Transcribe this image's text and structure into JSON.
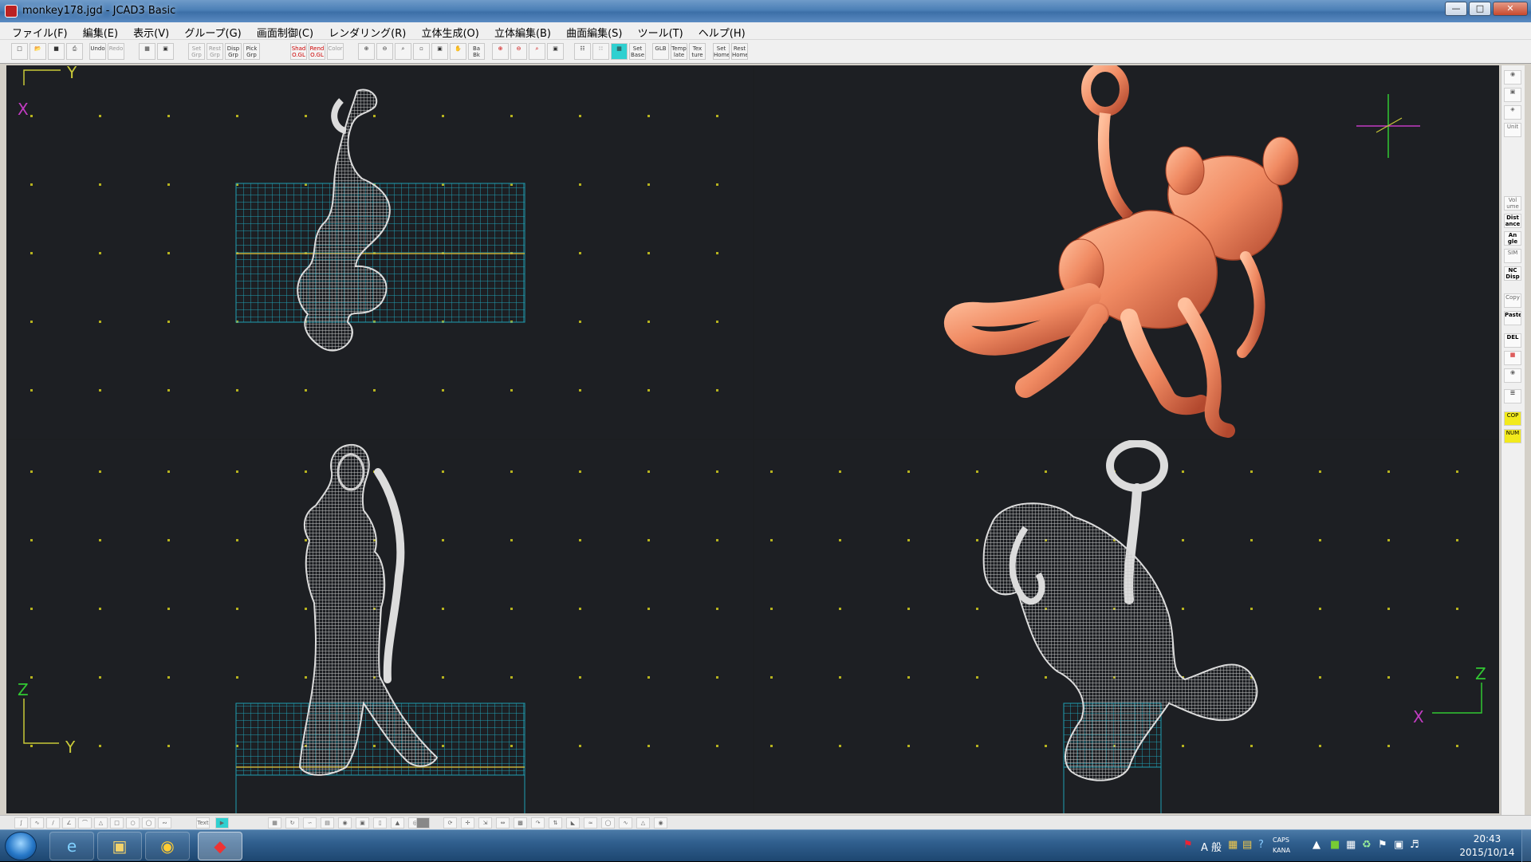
{
  "window": {
    "title": "monkey178.jgd - JCAD3 Basic"
  },
  "menu": [
    "ファイル(F)",
    "編集(E)",
    "表示(V)",
    "グループ(G)",
    "画面制御(C)",
    "レンダリング(R)",
    "立体生成(O)",
    "立体編集(B)",
    "曲面編集(S)",
    "ツール(T)",
    "ヘルプ(H)"
  ],
  "toolbar": {
    "undo": "Undo",
    "redo": "Redo",
    "set_grp": "Set Grp",
    "reset_grp": "Rest Grp",
    "disp_grp": "Disp Grp",
    "pick_grp": "Pick Grp",
    "shad_ogl": "Shad O.GL",
    "rend_ogl": "Rend O.GL",
    "color": "Color",
    "ba_bk": "Ba Bk",
    "set_base": "Set Base",
    "glb": "GLB",
    "template": "Temp late",
    "texture": "Tex ture",
    "set_home": "Set Home",
    "rest_home": "Rest Home"
  },
  "viewports": {
    "top_left": {
      "axis_h": "Y",
      "axis_v": "X"
    },
    "bottom_left": {
      "axis_v": "Z",
      "axis_h": "Y"
    },
    "bottom_right": {
      "axis_v": "Z",
      "axis_h": "X"
    }
  },
  "right_toolbar": [
    "Vol ume",
    "Dist ance",
    "An gle",
    "SIM",
    "NC Disp",
    "Copy",
    "Paste",
    "DEL",
    "COP",
    "NUM"
  ],
  "bottom_toolbar": {
    "text": "Text"
  },
  "taskbar": {
    "apps": [
      "internet-explorer",
      "file-explorer",
      "chrome",
      "jcad3"
    ],
    "ime": "A 般",
    "caps": "CAPS",
    "kana": "KANA",
    "clock_time": "20:43",
    "clock_date": "2015/10/14"
  },
  "colors": {
    "viewport_bg": "#1d1f23",
    "grid_dot": "#b6b21e",
    "base_grid": "#1f9fb3",
    "mesh": "#c8c8c8",
    "render": "#f08a62",
    "axis_y": "#c8c838",
    "axis_x": "#c23cc2",
    "axis_z": "#32c832"
  }
}
